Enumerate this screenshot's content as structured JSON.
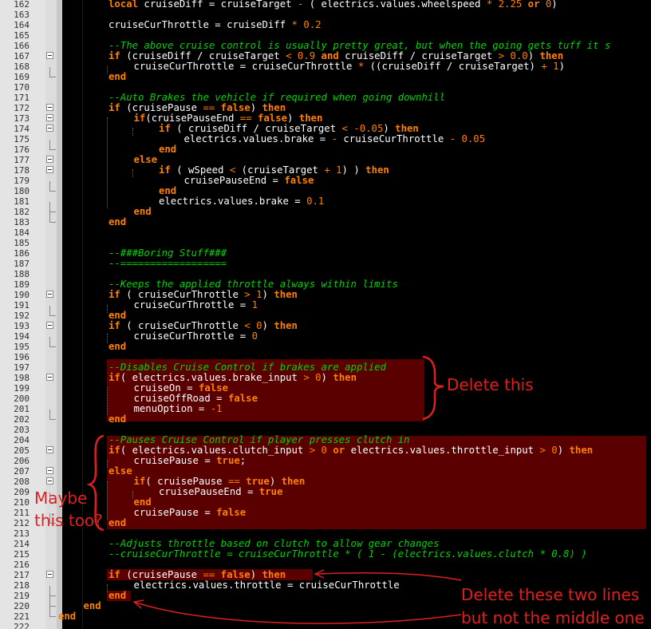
{
  "editor": {
    "lines": [
      {
        "n": "162",
        "indent": 0,
        "tokens": [
          [
            "kw",
            "local"
          ],
          [
            "t",
            " cruiseDiff = cruiseTarget "
          ],
          [
            "op",
            "-"
          ],
          [
            "t",
            " ( electrics.values.wheelspeed "
          ],
          [
            "op",
            "*"
          ],
          [
            "nm",
            " 2.25 "
          ],
          [
            "kw",
            "or"
          ],
          [
            "nm",
            " 0"
          ],
          [
            "t",
            ")"
          ]
        ]
      },
      {
        "n": "163",
        "indent": 0,
        "tokens": []
      },
      {
        "n": "164",
        "indent": 0,
        "tokens": [
          [
            "t",
            "cruiseCurThrottle = cruiseDiff "
          ],
          [
            "op",
            "*"
          ],
          [
            "nm",
            " 0.2"
          ]
        ]
      },
      {
        "n": "165",
        "indent": 0,
        "tokens": []
      },
      {
        "n": "166",
        "indent": 0,
        "tokens": [
          [
            "cm",
            "--The above cruise control is usually pretty great, but when the going gets tuff it s"
          ]
        ]
      },
      {
        "n": "167",
        "indent": 0,
        "fold": "start",
        "tokens": [
          [
            "kw",
            "if"
          ],
          [
            "t",
            " (cruiseDiff / cruiseTarget "
          ],
          [
            "op",
            "<"
          ],
          [
            "nm",
            " 0.9 "
          ],
          [
            "kw",
            "and"
          ],
          [
            "t",
            " cruiseDiff / cruiseTarget "
          ],
          [
            "op",
            ">"
          ],
          [
            "nm",
            " 0.0"
          ],
          [
            "t",
            ") "
          ],
          [
            "kw",
            "then"
          ]
        ]
      },
      {
        "n": "168",
        "indent": 1,
        "tokens": [
          [
            "t",
            "cruiseCurThrottle = cruiseCurThrottle "
          ],
          [
            "op",
            "*"
          ],
          [
            "t",
            " ((cruiseDiff / cruiseTarget) "
          ],
          [
            "op",
            "+"
          ],
          [
            "nm",
            " 1"
          ],
          [
            "t",
            ")"
          ]
        ]
      },
      {
        "n": "169",
        "indent": 0,
        "fold": "end",
        "tokens": [
          [
            "kw",
            "end"
          ]
        ]
      },
      {
        "n": "170",
        "indent": 0,
        "tokens": []
      },
      {
        "n": "171",
        "indent": 0,
        "tokens": [
          [
            "cm",
            "--Auto Brakes the vehicle if required when going downhill"
          ]
        ]
      },
      {
        "n": "172",
        "indent": 0,
        "fold": "start",
        "tokens": [
          [
            "kw",
            "if"
          ],
          [
            "t",
            " (cruisePause "
          ],
          [
            "op",
            "=="
          ],
          [
            "kw",
            " false"
          ],
          [
            "t",
            ") "
          ],
          [
            "kw",
            "then"
          ]
        ]
      },
      {
        "n": "173",
        "indent": 1,
        "fold": "start",
        "tokens": [
          [
            "kw",
            "if"
          ],
          [
            "t",
            "(cruisePauseEnd "
          ],
          [
            "op",
            "=="
          ],
          [
            "kw",
            " false"
          ],
          [
            "t",
            ") "
          ],
          [
            "kw",
            "then"
          ]
        ]
      },
      {
        "n": "174",
        "indent": 2,
        "fold": "start",
        "tokens": [
          [
            "kw",
            "if"
          ],
          [
            "t",
            " ( cruiseDiff / cruiseTarget "
          ],
          [
            "op",
            "<"
          ],
          [
            "op",
            " -"
          ],
          [
            "nm",
            "0.05"
          ],
          [
            "t",
            ") "
          ],
          [
            "kw",
            "then"
          ]
        ]
      },
      {
        "n": "175",
        "indent": 3,
        "tokens": [
          [
            "t",
            "electrics.values.brake = "
          ],
          [
            "op",
            "-"
          ],
          [
            "t",
            " cruiseCurThrottle "
          ],
          [
            "op",
            "-"
          ],
          [
            "nm",
            " 0.05"
          ]
        ]
      },
      {
        "n": "176",
        "indent": 2,
        "fold": "end",
        "tokens": [
          [
            "kw",
            "end"
          ]
        ]
      },
      {
        "n": "177",
        "indent": 1,
        "fold": "mid",
        "tokens": [
          [
            "kw",
            "else"
          ]
        ]
      },
      {
        "n": "178",
        "indent": 2,
        "fold": "start",
        "tokens": [
          [
            "kw",
            "if"
          ],
          [
            "t",
            " ( wSpeed "
          ],
          [
            "op",
            "<"
          ],
          [
            "t",
            " (cruiseTarget "
          ],
          [
            "op",
            "+"
          ],
          [
            "nm",
            " 1"
          ],
          [
            "t",
            ") ) "
          ],
          [
            "kw",
            "then"
          ]
        ]
      },
      {
        "n": "179",
        "indent": 3,
        "tokens": [
          [
            "t",
            "cruisePauseEnd = "
          ],
          [
            "kw",
            "false"
          ]
        ]
      },
      {
        "n": "180",
        "indent": 2,
        "fold": "end",
        "tokens": [
          [
            "kw",
            "end"
          ]
        ]
      },
      {
        "n": "181",
        "indent": 2,
        "tokens": [
          [
            "t",
            "electrics.values.brake = "
          ],
          [
            "nm",
            "0.1"
          ]
        ]
      },
      {
        "n": "182",
        "indent": 1,
        "fold": "end",
        "tokens": [
          [
            "kw",
            "end"
          ]
        ]
      },
      {
        "n": "183",
        "indent": 0,
        "fold": "end",
        "tokens": [
          [
            "kw",
            "end"
          ]
        ]
      },
      {
        "n": "184",
        "indent": 0,
        "tokens": []
      },
      {
        "n": "185",
        "indent": 0,
        "tokens": []
      },
      {
        "n": "186",
        "indent": 0,
        "tokens": [
          [
            "cm",
            "--###Boring Stuff###"
          ]
        ]
      },
      {
        "n": "187",
        "indent": 0,
        "tokens": [
          [
            "cm",
            "--=================="
          ]
        ]
      },
      {
        "n": "188",
        "indent": 0,
        "tokens": []
      },
      {
        "n": "189",
        "indent": 0,
        "tokens": [
          [
            "cm",
            "--Keeps the applied throttle always within limits"
          ]
        ]
      },
      {
        "n": "190",
        "indent": 0,
        "fold": "start",
        "tokens": [
          [
            "kw",
            "if"
          ],
          [
            "t",
            " ( cruiseCurThrottle "
          ],
          [
            "op",
            ">"
          ],
          [
            "nm",
            " 1"
          ],
          [
            "t",
            ") "
          ],
          [
            "kw",
            "then"
          ]
        ]
      },
      {
        "n": "191",
        "indent": 1,
        "tokens": [
          [
            "t",
            "cruiseCurThrottle = "
          ],
          [
            "nm",
            "1"
          ]
        ]
      },
      {
        "n": "192",
        "indent": 0,
        "fold": "end",
        "tokens": [
          [
            "kw",
            "end"
          ]
        ]
      },
      {
        "n": "193",
        "indent": 0,
        "fold": "start",
        "tokens": [
          [
            "kw",
            "if"
          ],
          [
            "t",
            " ( cruiseCurThrottle "
          ],
          [
            "op",
            "<"
          ],
          [
            "nm",
            " 0"
          ],
          [
            "t",
            ") "
          ],
          [
            "kw",
            "then"
          ]
        ]
      },
      {
        "n": "194",
        "indent": 1,
        "tokens": [
          [
            "t",
            "cruiseCurThrottle = "
          ],
          [
            "nm",
            "0"
          ]
        ]
      },
      {
        "n": "195",
        "indent": 0,
        "fold": "end",
        "tokens": [
          [
            "kw",
            "end"
          ]
        ]
      },
      {
        "n": "196",
        "indent": 0,
        "tokens": []
      },
      {
        "n": "197",
        "indent": 0,
        "tokens": [
          [
            "cm",
            "--Disables Cruise Control if brakes are applied"
          ]
        ]
      },
      {
        "n": "198",
        "indent": 0,
        "fold": "start",
        "tokens": [
          [
            "kw",
            "if"
          ],
          [
            "t",
            "( electrics.values.brake_input "
          ],
          [
            "op",
            ">"
          ],
          [
            "nm",
            " 0"
          ],
          [
            "t",
            ") "
          ],
          [
            "kw",
            "then"
          ]
        ]
      },
      {
        "n": "199",
        "indent": 1,
        "tokens": [
          [
            "t",
            "cruiseOn = "
          ],
          [
            "kw",
            "false"
          ]
        ]
      },
      {
        "n": "200",
        "indent": 1,
        "tokens": [
          [
            "t",
            "cruiseOffRoad = "
          ],
          [
            "kw",
            "false"
          ]
        ]
      },
      {
        "n": "201",
        "indent": 1,
        "tokens": [
          [
            "t",
            "menuOption = "
          ],
          [
            "op",
            "-"
          ],
          [
            "nm",
            "1"
          ]
        ]
      },
      {
        "n": "202",
        "indent": 0,
        "fold": "end",
        "tokens": [
          [
            "kw",
            "end"
          ]
        ]
      },
      {
        "n": "203",
        "indent": 0,
        "tokens": []
      },
      {
        "n": "204",
        "indent": 0,
        "tokens": [
          [
            "cm",
            "--Pauses Cruise Control if player presses clutch in"
          ]
        ]
      },
      {
        "n": "205",
        "indent": 0,
        "fold": "start",
        "tokens": [
          [
            "kw",
            "if"
          ],
          [
            "t",
            "( electrics.values.clutch_input "
          ],
          [
            "op",
            ">"
          ],
          [
            "nm",
            " 0 "
          ],
          [
            "kw",
            "or"
          ],
          [
            "t",
            " electrics.values.throttle_input "
          ],
          [
            "op",
            ">"
          ],
          [
            "nm",
            " 0"
          ],
          [
            "t",
            ") "
          ],
          [
            "kw",
            "then"
          ]
        ]
      },
      {
        "n": "206",
        "indent": 1,
        "tokens": [
          [
            "t",
            "cruisePause = "
          ],
          [
            "kw",
            "true"
          ],
          [
            "t",
            ";"
          ]
        ]
      },
      {
        "n": "207",
        "indent": 0,
        "fold": "mid",
        "tokens": [
          [
            "kw",
            "else"
          ]
        ]
      },
      {
        "n": "208",
        "indent": 1,
        "fold": "start",
        "tokens": [
          [
            "kw",
            "if"
          ],
          [
            "t",
            "( cruisePause "
          ],
          [
            "op",
            "=="
          ],
          [
            "kw",
            " true"
          ],
          [
            "t",
            ") "
          ],
          [
            "kw",
            "then"
          ]
        ]
      },
      {
        "n": "209",
        "indent": 2,
        "tokens": [
          [
            "t",
            "cruisePauseEnd = "
          ],
          [
            "kw",
            "true"
          ]
        ]
      },
      {
        "n": "210",
        "indent": 1,
        "fold": "end",
        "tokens": [
          [
            "kw",
            "end"
          ]
        ]
      },
      {
        "n": "211",
        "indent": 1,
        "tokens": [
          [
            "t",
            "cruisePause = "
          ],
          [
            "kw",
            "false"
          ]
        ]
      },
      {
        "n": "212",
        "indent": 0,
        "fold": "end",
        "tokens": [
          [
            "kw",
            "end"
          ]
        ]
      },
      {
        "n": "213",
        "indent": 0,
        "tokens": []
      },
      {
        "n": "214",
        "indent": 0,
        "tokens": [
          [
            "cm",
            "--Adjusts throttle based on clutch to allow gear changes"
          ]
        ]
      },
      {
        "n": "215",
        "indent": 0,
        "tokens": [
          [
            "cm",
            "--cruiseCurThrottle = cruiseCurThrottle * ( 1 - (electrics.values.clutch * 0.8) )"
          ]
        ]
      },
      {
        "n": "216",
        "indent": 0,
        "tokens": []
      },
      {
        "n": "217",
        "indent": 0,
        "fold": "start",
        "tokens": [
          [
            "kw",
            "if"
          ],
          [
            "t",
            " (cruisePause "
          ],
          [
            "op",
            "=="
          ],
          [
            "kw",
            " false"
          ],
          [
            "t",
            ") "
          ],
          [
            "kw",
            "then"
          ]
        ]
      },
      {
        "n": "218",
        "indent": 1,
        "tokens": [
          [
            "t",
            "electrics.values.throttle = cruiseCurThrottle"
          ]
        ]
      },
      {
        "n": "219",
        "indent": 0,
        "fold": "end",
        "tokens": [
          [
            "kw",
            "end"
          ]
        ]
      },
      {
        "n": "220",
        "indent": -1,
        "fold": "end",
        "tokens": [
          [
            "kw",
            "end"
          ]
        ]
      },
      {
        "n": "221",
        "indent": -2,
        "fold": "end",
        "tokens": [
          [
            "kw",
            "end"
          ]
        ]
      },
      {
        "n": "222",
        "indent": 0,
        "tokens": []
      }
    ]
  },
  "annotations": {
    "delete_this": "Delete this",
    "maybe_line1": "Maybe",
    "maybe_line2": "this too?",
    "delete_two_line1": "Delete these two lines",
    "delete_two_line2": "but not the middle one"
  },
  "colors": {
    "keyword": "#ff8000",
    "comment": "#00d400",
    "highlight": "#5a0000",
    "annotation": "#e02020"
  }
}
